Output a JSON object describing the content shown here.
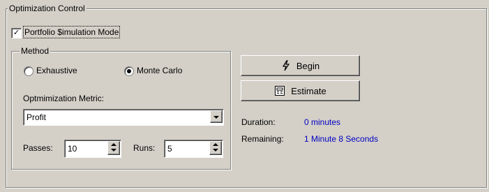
{
  "group_title": "Optimization Control",
  "portfolio_mode": {
    "label": "Portfolio $imulation Mode",
    "checked": true
  },
  "method": {
    "title": "Method",
    "options": [
      "Exhaustive",
      "Monte Carlo"
    ],
    "selected": "Monte Carlo"
  },
  "metric": {
    "label": "Optmimization Metric:",
    "value": "Profit"
  },
  "passes": {
    "label": "Passes:",
    "value": "10"
  },
  "runs": {
    "label": "Runs:",
    "value": "5"
  },
  "buttons": {
    "begin": "Begin",
    "estimate": "Estimate"
  },
  "status": {
    "duration_label": "Duration:",
    "duration_value": "0 minutes",
    "remaining_label": "Remaining:",
    "remaining_value": "1 Minute 8 Seconds"
  },
  "icons": {
    "begin": "lightning-icon",
    "estimate": "calculator-icon"
  },
  "colors": {
    "background": "#d4d0c8",
    "status_value": "#0000c0"
  }
}
